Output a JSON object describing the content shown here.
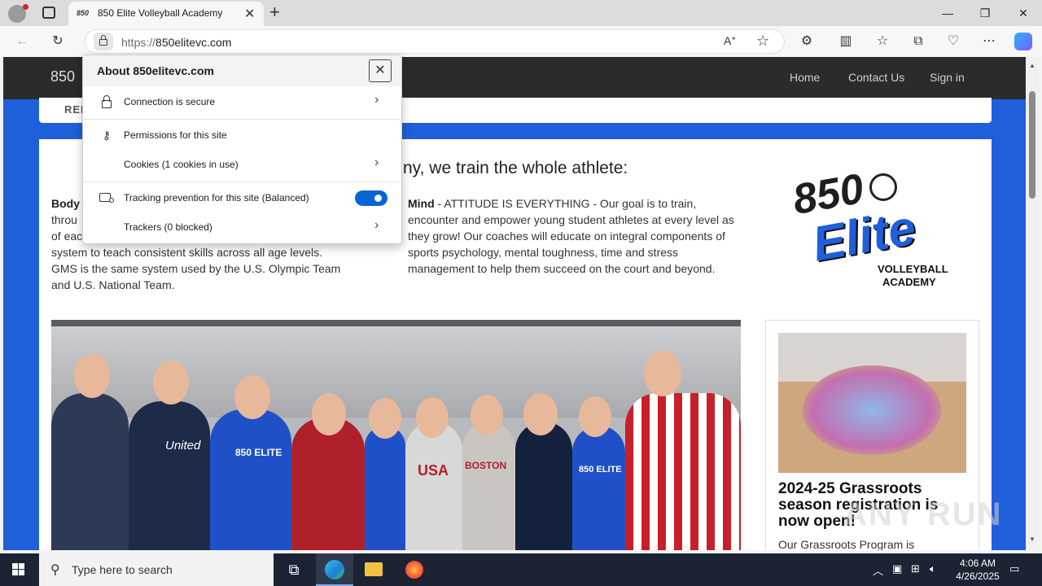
{
  "browser": {
    "tab_title": "850 Elite Volleyball Academy",
    "url_scheme": "https://",
    "url_host": "850elitevc.com",
    "new_tab_label": "+"
  },
  "site": {
    "brand": "850",
    "nav": [
      "Home",
      "Contact Us",
      "Sign in"
    ],
    "subbar_label": "REI",
    "heading": "ny, we train the whole athlete:",
    "body_col": {
      "lead": "Body",
      "line1": "throu",
      "line2": "of eac",
      "line3": "system to teach consistent skills across all age levels.",
      "line4": "GMS is the same system used by the U.S. Olympic Team",
      "line5": "and U.S. National Team."
    },
    "mind_col": {
      "lead": "Mind",
      "text": " - ATTITUDE IS EVERYTHING - Our goal is to train, encounter and empower young student athletes at every level as they grow! Our coaches will educate on integral components of sports psychology, mental toughness, time and stress management to help them succeed on the court and beyond."
    },
    "logo": {
      "number": "850",
      "word": "Elite",
      "line1": "VOLLEYBALL",
      "line2": "ACADEMY"
    },
    "card": {
      "title": "2024-25 Grassroots season registration is now open!",
      "text": "Our Grassroots Program is"
    },
    "watermark": "ANY RUN",
    "photo_shirts": [
      "United",
      "850 ELITE",
      "850 ELITE",
      "USA",
      "BOSTON",
      "850 ELITE"
    ]
  },
  "popup": {
    "title": "About 850elitevc.com",
    "close_icon": "close-icon",
    "rows": [
      {
        "label": "Connection is secure",
        "icon": "lock-icon"
      },
      {
        "label": "Permissions for this site",
        "icon": "key-icon"
      },
      {
        "label": "Cookies (1 cookies in use)",
        "icon": ""
      },
      {
        "label": "Tracking prevention for this site (Balanced)",
        "icon": "tracking-icon"
      },
      {
        "label": "Trackers (0 blocked)",
        "icon": ""
      }
    ],
    "tracking_enabled": true
  },
  "taskbar": {
    "search_placeholder": "Type here to search",
    "time": "4:06 AM",
    "date": "4/26/2025"
  },
  "colors": {
    "accent": "#1f5fd9",
    "toggle": "#0a64d2",
    "nav_bg": "#2b2b2b"
  }
}
